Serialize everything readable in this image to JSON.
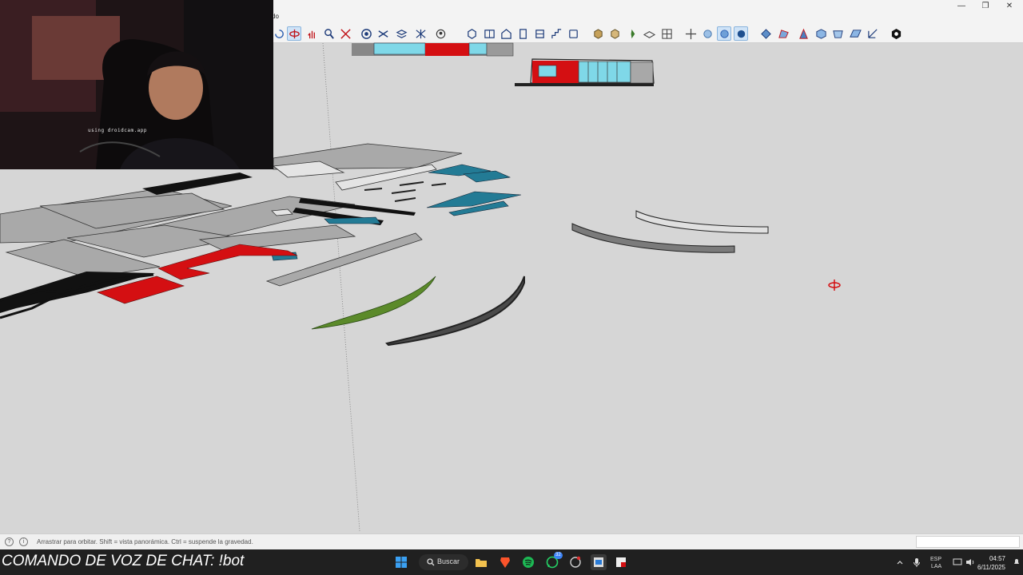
{
  "window": {
    "title_fragment": "do",
    "minimize": "—",
    "maximize": "❐",
    "close": "✕"
  },
  "toolbar": {
    "icons": [
      "orbit-icon",
      "pan-icon",
      "zoom-icon",
      "zoom-extents-icon",
      "component-icon",
      "section-icon",
      "layers-icon",
      "styles-icon",
      "camera-icon",
      "box-icon",
      "wall-icon",
      "house-icon",
      "door-icon",
      "window-icon",
      "stair-icon",
      "shape-icon",
      "component-box-icon",
      "paint-icon",
      "pin-icon",
      "texture-icon",
      "grid-icon",
      "move-icon",
      "hand-icon",
      "lasso-icon",
      "globe-icon",
      "solid-icon",
      "sandbox-icon",
      "terrain-icon",
      "cube-icon",
      "mesh-icon",
      "plane-icon",
      "extension-icon"
    ],
    "active": [
      "orbit-icon"
    ]
  },
  "webcam": {
    "overlay_text": "using droidcam.app"
  },
  "status": {
    "hint": "Arrastrar para orbitar. Shift = vista panorámica. Ctrl = suspende la gravedad."
  },
  "taskbar": {
    "chat_command": "COMANDO DE VOZ DE CHAT: !bot",
    "search_label": "Buscar",
    "whatsapp_badge": "32",
    "lang_top": "ESP",
    "lang_bottom": "LAA",
    "time": "04:57",
    "date": "6/11/2025"
  },
  "colors": {
    "viewport_bg": "#d6d6d6",
    "taskbar_bg": "#202020",
    "accent_red": "#d40f12",
    "accent_teal": "#237b95",
    "accent_green": "#5b8a2a"
  }
}
